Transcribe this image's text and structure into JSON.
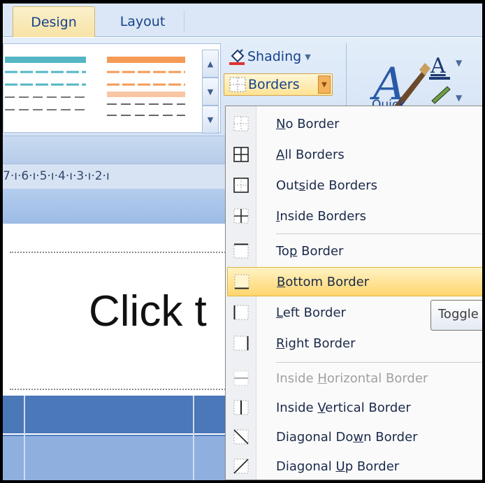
{
  "tabs": [
    {
      "label": "Design",
      "active": true
    },
    {
      "label": "Layout",
      "active": false
    }
  ],
  "ribbon": {
    "shading_label": "Shading",
    "borders_label": "Borders",
    "quick_label": "Quick",
    "colors": {
      "accent_orange": "#f4b25c",
      "ribbon_blue": "#dbe7f6",
      "highlight": "#ffd56e"
    }
  },
  "ruler": {
    "text": "7·ı·6·ı·5·ı·4·ı·3·ı·2·ı"
  },
  "slide": {
    "title_text": "Click t"
  },
  "borders_menu": {
    "items": [
      {
        "pre": "",
        "key": "N",
        "post": "o Border",
        "icon": "no-border-icon",
        "disabled": false,
        "highlighted": false
      },
      {
        "pre": "",
        "key": "A",
        "post": "ll Borders",
        "icon": "all-borders-icon",
        "disabled": false,
        "highlighted": false
      },
      {
        "pre": "Out",
        "key": "s",
        "post": "ide Borders",
        "icon": "outside-borders-icon",
        "disabled": false,
        "highlighted": false
      },
      {
        "pre": "",
        "key": "I",
        "post": "nside Borders",
        "icon": "inside-borders-icon",
        "disabled": false,
        "highlighted": false
      },
      {
        "pre": "To",
        "key": "p",
        "post": " Border",
        "icon": "top-border-icon",
        "disabled": false,
        "highlighted": false
      },
      {
        "pre": "",
        "key": "B",
        "post": "ottom Border",
        "icon": "bottom-border-icon",
        "disabled": false,
        "highlighted": true
      },
      {
        "pre": "",
        "key": "L",
        "post": "eft Border",
        "icon": "left-border-icon",
        "disabled": false,
        "highlighted": false
      },
      {
        "pre": "",
        "key": "R",
        "post": "ight Border",
        "icon": "right-border-icon",
        "disabled": false,
        "highlighted": false
      },
      {
        "pre": "Inside ",
        "key": "H",
        "post": "orizontal Border",
        "icon": "inside-horizontal-border-icon",
        "disabled": true,
        "highlighted": false
      },
      {
        "pre": "Inside ",
        "key": "V",
        "post": "ertical Border",
        "icon": "inside-vertical-border-icon",
        "disabled": false,
        "highlighted": false
      },
      {
        "pre": "Diagonal Do",
        "key": "w",
        "post": "n Border",
        "icon": "diagonal-down-border-icon",
        "disabled": false,
        "highlighted": false
      },
      {
        "pre": "Diagonal ",
        "key": "U",
        "post": "p Border",
        "icon": "diagonal-up-border-icon",
        "disabled": false,
        "highlighted": false
      }
    ]
  },
  "tooltip": {
    "text": "Toggle"
  }
}
